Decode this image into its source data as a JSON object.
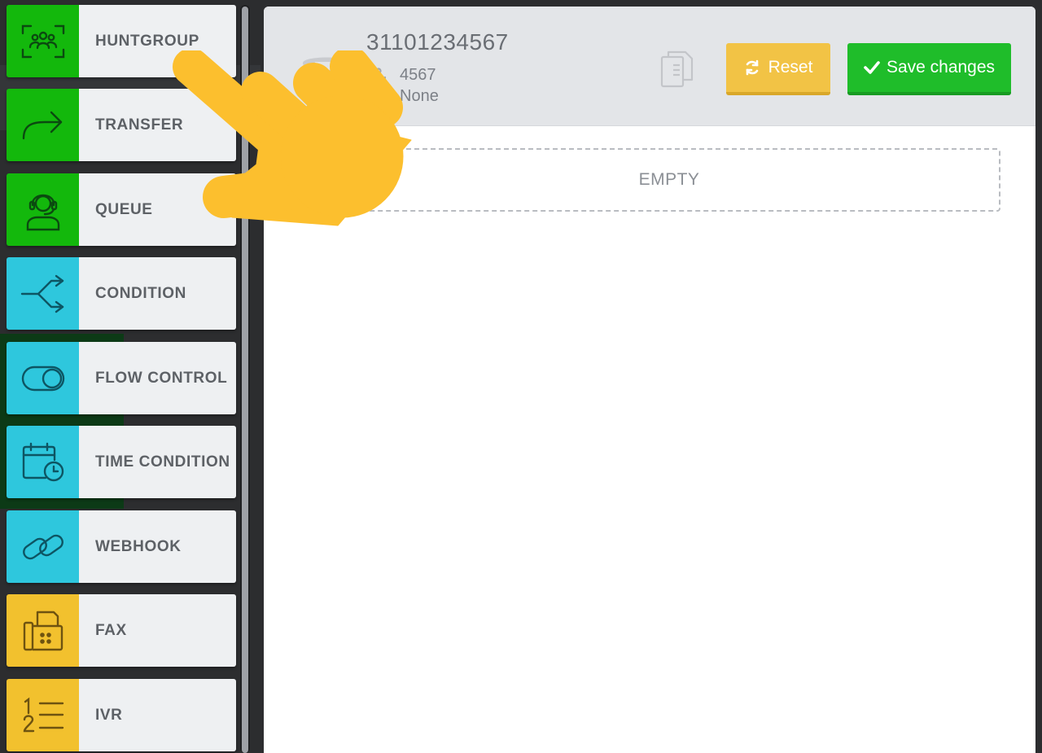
{
  "palette": {
    "items": [
      {
        "label": "HUNTGROUP",
        "icon": "huntgroup-icon",
        "color": "#13b80c"
      },
      {
        "label": "TRANSFER",
        "icon": "transfer-arrow-icon",
        "color": "#13b80c"
      },
      {
        "label": "QUEUE",
        "icon": "headset-agent-icon",
        "color": "#13b80c"
      },
      {
        "label": "CONDITION",
        "icon": "branch-split-icon",
        "color": "#2ec7dd"
      },
      {
        "label": "FLOW CONTROL",
        "icon": "toggle-icon",
        "color": "#2ec7dd"
      },
      {
        "label": "TIME CONDITION",
        "icon": "calendar-clock-icon",
        "color": "#2ec7dd"
      },
      {
        "label": "WEBHOOK",
        "icon": "link-icon",
        "color": "#2ec7dd"
      },
      {
        "label": "FAX",
        "icon": "fax-icon",
        "color": "#f2c12e"
      },
      {
        "label": "IVR",
        "icon": "numbered-list-icon",
        "color": "#f2c12e"
      }
    ]
  },
  "header": {
    "number": "31101234567",
    "extension": "4567",
    "secondary": "None",
    "reset_label": "Reset",
    "save_label": "Save changes"
  },
  "dropzone": {
    "label": "EMPTY"
  },
  "colors": {
    "green": "#13b80c",
    "cyan": "#2ec7dd",
    "yellow": "#f2c12e",
    "save": "#1fbd2a",
    "reset": "#f2c345",
    "hand": "#fcbf2e"
  }
}
